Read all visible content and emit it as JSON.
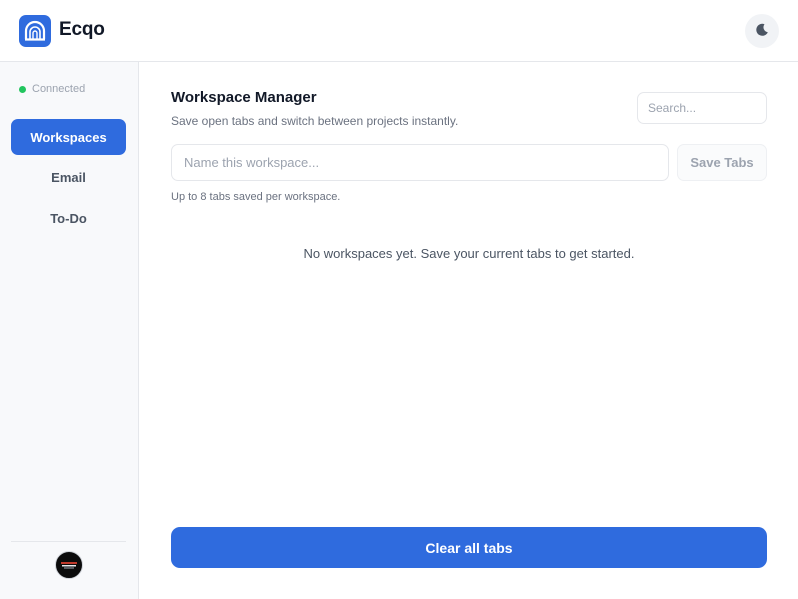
{
  "app": {
    "name": "Ecqo",
    "logo_icon": "rainbow-arch-icon",
    "accent_color": "#2f6bde"
  },
  "header": {
    "theme_toggle_icon": "moon-icon"
  },
  "sidebar": {
    "status_text": "Connected",
    "status_color": "#22c55e",
    "items": [
      {
        "label": "Workspaces",
        "active": true
      },
      {
        "label": "Email",
        "active": false
      },
      {
        "label": "To-Do",
        "active": false
      }
    ],
    "avatar_icon": "user-avatar"
  },
  "main": {
    "title": "Workspace Manager",
    "subtitle": "Save open tabs and switch between projects instantly.",
    "search": {
      "placeholder": "Search...",
      "value": ""
    },
    "name_input": {
      "placeholder": "Name this workspace...",
      "value": ""
    },
    "save_button_label": "Save Tabs",
    "hint": "Up to 8 tabs saved per workspace.",
    "empty_state": "No workspaces yet. Save your current tabs to get started.",
    "clear_button_label": "Clear all tabs"
  }
}
